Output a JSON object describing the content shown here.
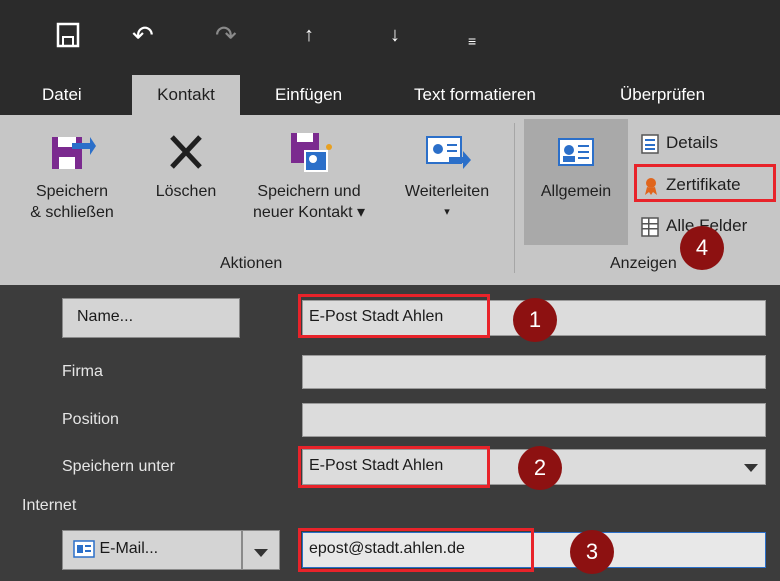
{
  "tabs": [
    "Datei",
    "Kontakt",
    "Einfügen",
    "Text formatieren",
    "Überprüfen"
  ],
  "ribbon": {
    "save_close": [
      "Speichern",
      "& schließen"
    ],
    "delete": "Löschen",
    "save_new": [
      "Speichern und",
      "neuer Kontakt ▾"
    ],
    "forward": "Weiterleiten",
    "forward_arrow": "▾",
    "general": "Allgemein",
    "details": "Details",
    "certificates": "Zertifikate",
    "all_fields": "Alle Felder",
    "group_actions": "Aktionen",
    "group_show": "Anzeigen"
  },
  "form": {
    "name_button": "Name...",
    "name_value": "E-Post Stadt Ahlen",
    "company_label": "Firma",
    "company_value": "",
    "position_label": "Position",
    "position_value": "",
    "file_as_label": "Speichern unter",
    "file_as_value": "E-Post Stadt Ahlen",
    "internet_label": "Internet",
    "email_button": "E-Mail...",
    "email_value": "epost@stadt.ahlen.de"
  },
  "callouts": [
    "1",
    "2",
    "3",
    "4"
  ],
  "colors": {
    "highlight": "#e8232a",
    "callout": "#8d1111"
  }
}
